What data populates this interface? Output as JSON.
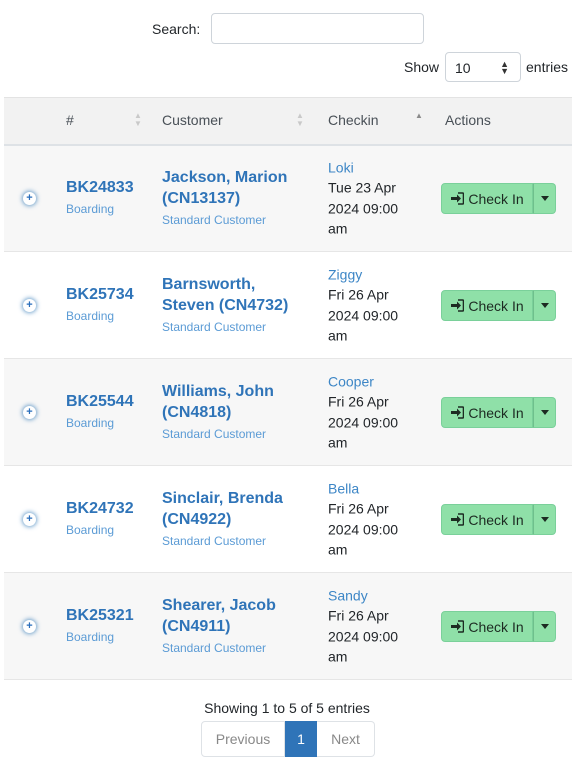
{
  "search": {
    "label": "Search:",
    "value": "",
    "placeholder": ""
  },
  "length": {
    "show_label": "Show",
    "selected": "10",
    "entries_label": "entries"
  },
  "table": {
    "columns": [
      "#",
      "Customer",
      "Checkin",
      "Actions"
    ],
    "rows": [
      {
        "id": "BK24833",
        "type": "Boarding",
        "customer": "Jackson, Marion (CN13137)",
        "customer_type": "Standard Customer",
        "pet": "Loki",
        "date": "Tue 23 Apr 2024 09:00 am",
        "action": "Check In"
      },
      {
        "id": "BK25734",
        "type": "Boarding",
        "customer": "Barnsworth, Steven (CN4732)",
        "customer_type": "Standard Customer",
        "pet": "Ziggy",
        "date": "Fri 26 Apr 2024 09:00 am",
        "action": "Check In"
      },
      {
        "id": "BK25544",
        "type": "Boarding",
        "customer": "Williams, John (CN4818)",
        "customer_type": "Standard Customer",
        "pet": "Cooper",
        "date": "Fri 26 Apr 2024 09:00 am",
        "action": "Check In"
      },
      {
        "id": "BK24732",
        "type": "Boarding",
        "customer": "Sinclair, Brenda (CN4922)",
        "customer_type": "Standard Customer",
        "pet": "Bella",
        "date": "Fri 26 Apr 2024 09:00 am",
        "action": "Check In"
      },
      {
        "id": "BK25321",
        "type": "Boarding",
        "customer": "Shearer, Jacob (CN4911)",
        "customer_type": "Standard Customer",
        "pet": "Sandy",
        "date": "Fri 26 Apr 2024 09:00 am",
        "action": "Check In"
      }
    ]
  },
  "info": "Showing 1 to 5 of 5 entries",
  "pagination": {
    "previous": "Previous",
    "current": "1",
    "next": "Next"
  },
  "colors": {
    "accent": "#2f74b8",
    "button": "#8fe0a8"
  }
}
